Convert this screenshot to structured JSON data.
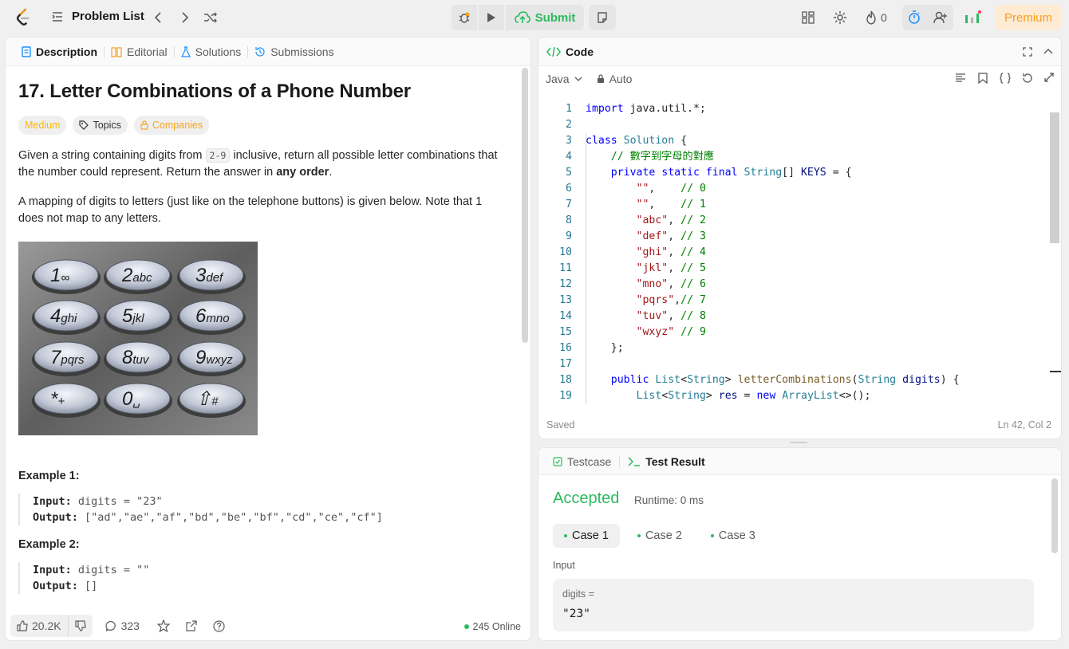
{
  "topbar": {
    "problem_list": "Problem List",
    "submit": "Submit",
    "fire_count": "0",
    "premium": "Premium"
  },
  "left": {
    "tabs": [
      "Description",
      "Editorial",
      "Solutions",
      "Submissions"
    ],
    "title": "17. Letter Combinations of a Phone Number",
    "chips": [
      "Medium",
      "Topics",
      "Companies"
    ],
    "para1_a": "Given a string containing digits from ",
    "para1_code": "2-9",
    "para1_b": " inclusive, return all possible letter combinations that the number could represent. Return the answer in ",
    "para1_bold": "any order",
    "para1_c": ".",
    "para2": "A mapping of digits to letters (just like on the telephone buttons) is given below. Note that 1 does not map to any letters.",
    "keypad": [
      {
        "d": "1",
        "l": "∞"
      },
      {
        "d": "2",
        "l": "abc"
      },
      {
        "d": "3",
        "l": "def"
      },
      {
        "d": "4",
        "l": "ghi"
      },
      {
        "d": "5",
        "l": "jkl"
      },
      {
        "d": "6",
        "l": "mno"
      },
      {
        "d": "7",
        "l": "pqrs"
      },
      {
        "d": "8",
        "l": "tuv"
      },
      {
        "d": "9",
        "l": "wxyz"
      },
      {
        "d": "*",
        "l": "+"
      },
      {
        "d": "0",
        "l": "␣"
      },
      {
        "d": "⇧",
        "l": "#"
      }
    ],
    "examples": [
      {
        "title": "Example 1:",
        "input_label": "Input:",
        "input": "digits = \"23\"",
        "output_label": "Output:",
        "output": "[\"ad\",\"ae\",\"af\",\"bd\",\"be\",\"bf\",\"cd\",\"ce\",\"cf\"]"
      },
      {
        "title": "Example 2:",
        "input_label": "Input:",
        "input": "digits = \"\"",
        "output_label": "Output:",
        "output": "[]"
      }
    ],
    "footer": {
      "likes": "20.2K",
      "comments": "323",
      "online": "245 Online"
    }
  },
  "code": {
    "header": "Code",
    "language": "Java",
    "auto": "Auto",
    "saved": "Saved",
    "cursor": "Ln 42, Col 2"
  },
  "test": {
    "tabs": [
      "Testcase",
      "Test Result"
    ],
    "status": "Accepted",
    "runtime": "Runtime: 0 ms",
    "cases": [
      "Case 1",
      "Case 2",
      "Case 3"
    ],
    "input_label": "Input",
    "var_name": "digits =",
    "var_value": "\"23\""
  },
  "colors": {
    "accent_green": "#2cbb5d",
    "medium": "#ffb800",
    "premium": "#f89f1b"
  }
}
